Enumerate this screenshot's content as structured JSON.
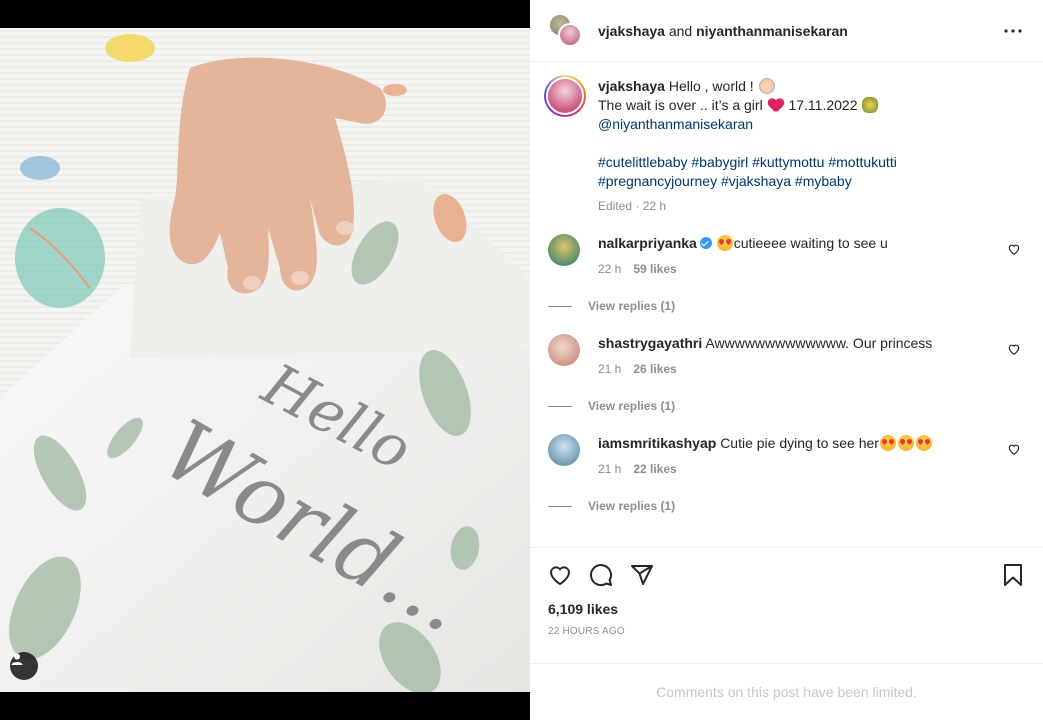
{
  "post": {
    "header": {
      "author": "vjakshaya",
      "and_text": "and",
      "collaborator": "niyanthanmanisekaran"
    },
    "caption": {
      "username": "vjakshaya",
      "line1": "Hello , world !",
      "line2a": "The wait is over .. it’s a girl",
      "line2b": "17.11.2022",
      "mention": "@niyanthanmanisekaran",
      "hashtags_line1": "#cutelittlebaby #babygirl #kuttymottu #mottukutti",
      "hashtags_line2": "#pregnancyjourney #vjakshaya #mybaby",
      "edited": "Edited",
      "time": "22 h"
    },
    "comments": [
      {
        "username": "nalkarpriyanka",
        "text": "cutieeee waiting to see u",
        "time": "22 h",
        "likes": "59 likes",
        "replies": "View replies (1)"
      },
      {
        "username": "shastrygayathri",
        "text": "Awwwwwwwwwwwww. Our princess",
        "time": "21 h",
        "likes": "26 likes",
        "replies": "View replies (1)"
      },
      {
        "username": "iamsmritikashyap",
        "text": "Cutie pie dying to see her",
        "time": "21 h",
        "likes": "22 likes",
        "replies": "View replies (1)"
      }
    ],
    "likes_count": "6,109 likes",
    "timestamp": "22 HOURS AGO",
    "comments_limited": "Comments on this post have been limited.",
    "image_text": {
      "line1": "Hello",
      "line2": "World..."
    }
  },
  "icons": {
    "more": "more-horizontal-icon",
    "like": "heart-icon",
    "comment": "comment-icon",
    "share": "paper-plane-icon",
    "save": "bookmark-icon",
    "tag": "user-tag-icon"
  },
  "colors": {
    "link": "#00376b",
    "muted": "#8e8e8e",
    "verified": "#3897f0",
    "heart_emoji": "#e0245e"
  }
}
